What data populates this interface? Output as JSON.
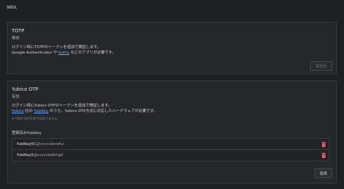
{
  "page": {
    "title": "MFA"
  },
  "totp": {
    "title": "TOTP",
    "status": "無効",
    "desc_line1": "ログイン時にTOTPのトークンを追加で検証します。",
    "desc_line2_prefix": "Google Authenticator や ",
    "desc_line2_link": "Authy",
    "desc_line2_suffix": " などのアプリが必要です。",
    "enable_button": "有効化"
  },
  "yubico": {
    "title": "Yubico OTP",
    "status": "有効",
    "desc_line1": "ログイン時にYubico OTPのトークンを追加で検証します。",
    "desc_line2_link1": "Yubico",
    "desc_line2_mid": " 社の ",
    "desc_line2_link2": "YubiKey",
    "desc_line2_suffix": " のうち、Yubico OTP方式に対応したハードウェアが必要です。",
    "note": "※ FIDO U2F方式ではありません",
    "registered_label": "登録済みYubiKey",
    "keys": [
      {
        "name": "YubiKey5C",
        "id": "@vvcccbereful"
      },
      {
        "name": "YubiKey5",
        "id": "@vvcccbdtthgd"
      }
    ],
    "add_button": "追加"
  },
  "colors": {
    "link": "#6ea8fe",
    "delete": "#e2566f",
    "background": "#1f2023",
    "panel": "#26272b"
  },
  "icons": {
    "delete": "trash-icon"
  }
}
